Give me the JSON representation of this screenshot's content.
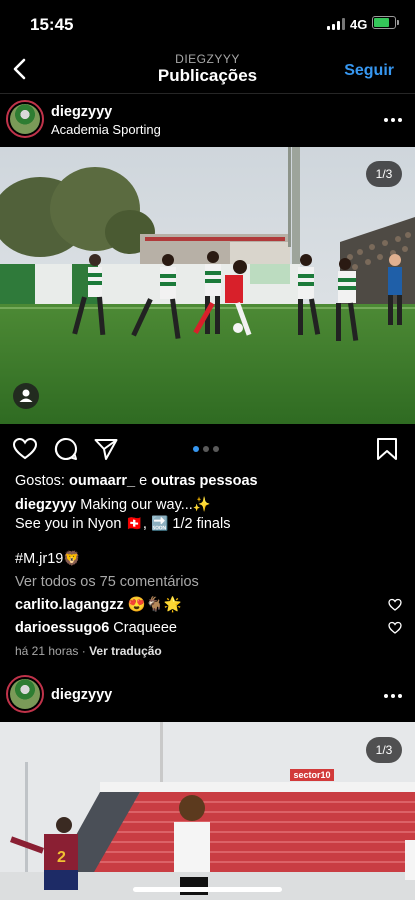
{
  "status_bar": {
    "time": "15:45",
    "network": "4G"
  },
  "nav": {
    "username": "DIEGZYYY",
    "title": "Publicações",
    "follow_label": "Seguir"
  },
  "post1": {
    "username": "diegzyyy",
    "location": "Academia Sporting",
    "photo_counter": "1/3",
    "likes_prefix": "Gostos: ",
    "likes_user": "oumaarr_",
    "likes_middle": " e ",
    "likes_suffix": "outras pessoas",
    "caption_user": "diegzyyy",
    "caption_line1": " Making our way...✨",
    "caption_line2_a": "See you in Nyon ",
    "caption_flag": "🇨🇭",
    "caption_line2_b": ", ",
    "caption_soon": "🔜",
    "caption_line2_c": " 1/2 finals",
    "hashtag": "#M.jr19",
    "hashtag_emoji": "🦁",
    "view_comments": "Ver todos os 75 comentários",
    "comments": [
      {
        "user": "carlito.lagangzz",
        "text": " 😍🐐🌟"
      },
      {
        "user": "darioessugo6",
        "text": " Craqueee"
      }
    ],
    "time_ago": "há 21 horas",
    "separator": " · ",
    "translate": "Ver tradução"
  },
  "post2": {
    "username": "diegzyyy",
    "photo_counter": "1/3",
    "stadium_sign": "sector10",
    "shirt_number": "2"
  },
  "colors": {
    "accent": "#3797f0",
    "background": "#000000",
    "muted": "#a8a8a8"
  }
}
